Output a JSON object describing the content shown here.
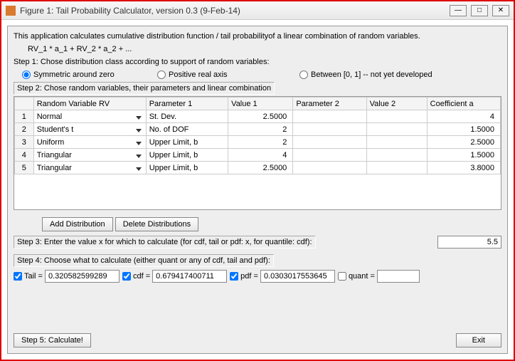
{
  "window": {
    "title": "Figure 1: Tail Probability Calculator, version 0.3 (9-Feb-14)",
    "min": "—",
    "max": "□",
    "close": "✕"
  },
  "intro": {
    "description": "This application calculates cumulative distribution function / tail probabilityof a linear combination of random variables.",
    "formula": "RV_1 * a_1 + RV_2 * a_2 + ..."
  },
  "step1": {
    "label": "Step 1: Chose distribution class according to support of random variables:",
    "opt_sym": "Symmetric around zero",
    "opt_pos": "Positive real axis",
    "opt_bet": "Between [0, 1] -- not yet developed",
    "selected": "sym"
  },
  "step2": {
    "label": "Step 2: Chose random variables, their parameters and linear combination",
    "headers": {
      "rv": "Random Variable RV",
      "p1": "Parameter 1",
      "v1": "Value 1",
      "p2": "Parameter 2",
      "v2": "Value 2",
      "coef": "Coefficient a"
    },
    "rows": [
      {
        "n": "1",
        "rv": "Normal",
        "p1": "St. Dev.",
        "v1": "2.5000",
        "p2": "",
        "v2": "",
        "coef": "4"
      },
      {
        "n": "2",
        "rv": "Student's t",
        "p1": "No. of DOF",
        "v1": "2",
        "p2": "",
        "v2": "",
        "coef": "1.5000"
      },
      {
        "n": "3",
        "rv": "Uniform",
        "p1": "Upper Limit, b",
        "v1": "2",
        "p2": "",
        "v2": "",
        "coef": "2.5000"
      },
      {
        "n": "4",
        "rv": "Triangular",
        "p1": "Upper Limit, b",
        "v1": "4",
        "p2": "",
        "v2": "",
        "coef": "1.5000"
      },
      {
        "n": "5",
        "rv": "Triangular",
        "p1": "Upper Limit, b",
        "v1": "2.5000",
        "p2": "",
        "v2": "",
        "coef": "3.8000"
      }
    ],
    "add_btn": "Add Distribution",
    "del_btn": "Delete Distributions"
  },
  "step3": {
    "label": "Step 3: Enter the value x for which to calculate (for cdf, tail or pdf: x, for quantile: cdf):",
    "value": "5.5"
  },
  "step4": {
    "label": "Step 4: Choose what to calculate (either quant or any of cdf, tail and pdf):",
    "tail_lbl": "Tail =",
    "tail_val": "0.320582599289",
    "tail_chk": true,
    "cdf_lbl": "cdf =",
    "cdf_val": "0.679417400711",
    "cdf_chk": true,
    "pdf_lbl": "pdf =",
    "pdf_val": "0.0303017553645",
    "pdf_chk": true,
    "quant_lbl": "quant =",
    "quant_val": "",
    "quant_chk": false
  },
  "step5": {
    "label": "Step 5: Calculate!"
  },
  "exit": "Exit"
}
